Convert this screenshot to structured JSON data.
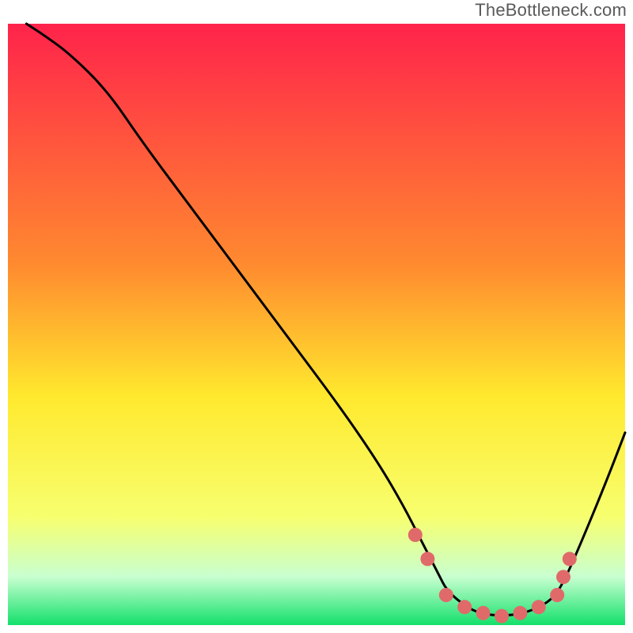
{
  "watermark": "TheBottleneck.com",
  "chart_data": {
    "type": "line",
    "title": "",
    "xlabel": "",
    "ylabel": "",
    "xlim": [
      0,
      100
    ],
    "ylim": [
      0,
      100
    ],
    "grid": false,
    "legend": false,
    "annotations": [],
    "background_gradient": {
      "top_color": "#ff234b",
      "mid_upper_color": "#ff8a2f",
      "mid_color": "#ffe92e",
      "mid_lower_color": "#f7ff6f",
      "low_band_color": "#c8ffd0",
      "bottom_color": "#12e06a"
    },
    "series": [
      {
        "name": "bottleneck-curve",
        "type": "line",
        "color": "#000000",
        "stroke_width": 2,
        "x": [
          3,
          6,
          10,
          16,
          22,
          30,
          38,
          46,
          54,
          60,
          64,
          67,
          69,
          70,
          71,
          73,
          76,
          80,
          84,
          88,
          90,
          93,
          97,
          100
        ],
        "values": [
          100,
          98,
          95,
          89,
          80,
          69,
          58,
          47,
          36,
          27,
          20,
          14,
          10,
          8,
          6,
          4,
          2,
          1.5,
          2,
          4,
          7,
          14,
          24,
          32
        ]
      },
      {
        "name": "valley-markers",
        "type": "scatter",
        "color": "#e06a6a",
        "marker_radius": 9,
        "x": [
          66,
          68,
          71,
          74,
          77,
          80,
          83,
          86,
          89,
          90,
          91
        ],
        "values": [
          15,
          11,
          5,
          3,
          2,
          1.5,
          2,
          3,
          5,
          8,
          11
        ]
      }
    ]
  }
}
